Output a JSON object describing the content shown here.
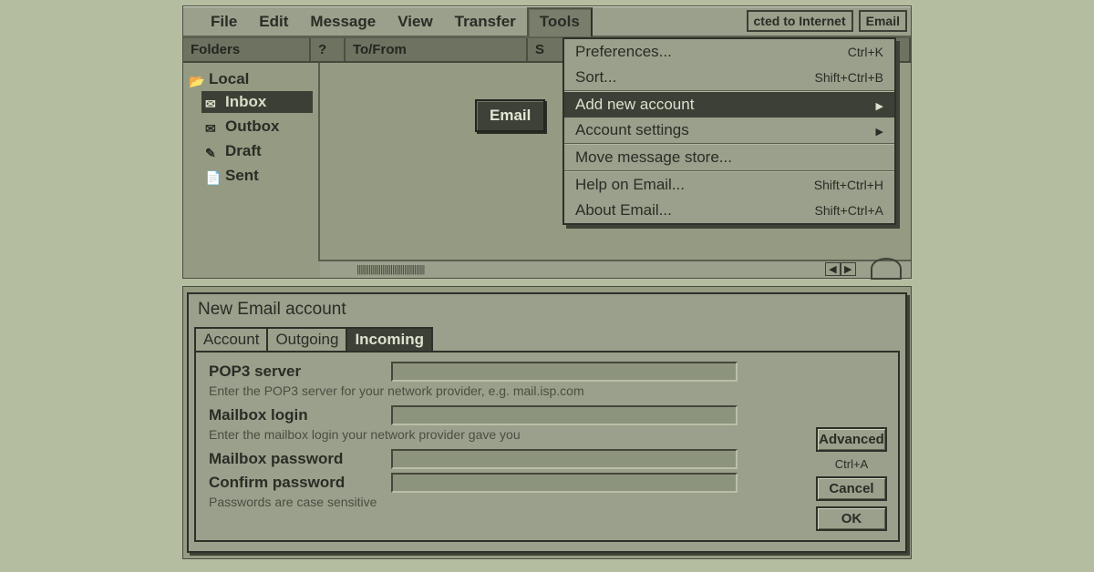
{
  "menubar": {
    "items": [
      "File",
      "Edit",
      "Message",
      "View",
      "Transfer",
      "Tools"
    ],
    "active_index": 5
  },
  "status": {
    "connection": "cted to Internet",
    "app": "Email"
  },
  "columns": {
    "folders": "Folders",
    "q": "?",
    "tofrom": "To/From",
    "s": "S"
  },
  "tree": {
    "root": "Local",
    "items": [
      "Inbox",
      "Outbox",
      "Draft",
      "Sent"
    ],
    "selected_index": 0
  },
  "submenu_tag": "Email",
  "tools_menu": {
    "items": [
      {
        "label": "Preferences...",
        "shortcut": "Ctrl+K"
      },
      {
        "label": "Sort...",
        "shortcut": "Shift+Ctrl+B"
      },
      {
        "label": "Add new account",
        "shortcut": "",
        "submenu": true
      },
      {
        "label": "Account settings",
        "shortcut": "",
        "submenu": true
      },
      {
        "label": "Move message store...",
        "shortcut": ""
      },
      {
        "label": "Help on Email...",
        "shortcut": "Shift+Ctrl+H"
      },
      {
        "label": "About Email...",
        "shortcut": "Shift+Ctrl+A"
      }
    ],
    "highlight_index": 2
  },
  "dialog": {
    "title": "New Email account",
    "tabs": [
      "Account",
      "Outgoing",
      "Incoming"
    ],
    "active_tab_index": 2,
    "pop3_label": "POP3 server",
    "pop3_hint": "Enter the POP3 server for your network provider, e.g. mail.isp.com",
    "login_label": "Mailbox login",
    "login_hint": "Enter the mailbox login your network provider gave you",
    "pass_label": "Mailbox password",
    "confirm_label": "Confirm password",
    "pass_hint": "Passwords are case sensitive",
    "buttons": {
      "advanced": "Advanced",
      "advanced_shortcut": "Ctrl+A",
      "cancel": "Cancel",
      "ok": "OK"
    }
  },
  "bottombar_ticks": "||||||||||||||||||||||||||||||||||||||||"
}
